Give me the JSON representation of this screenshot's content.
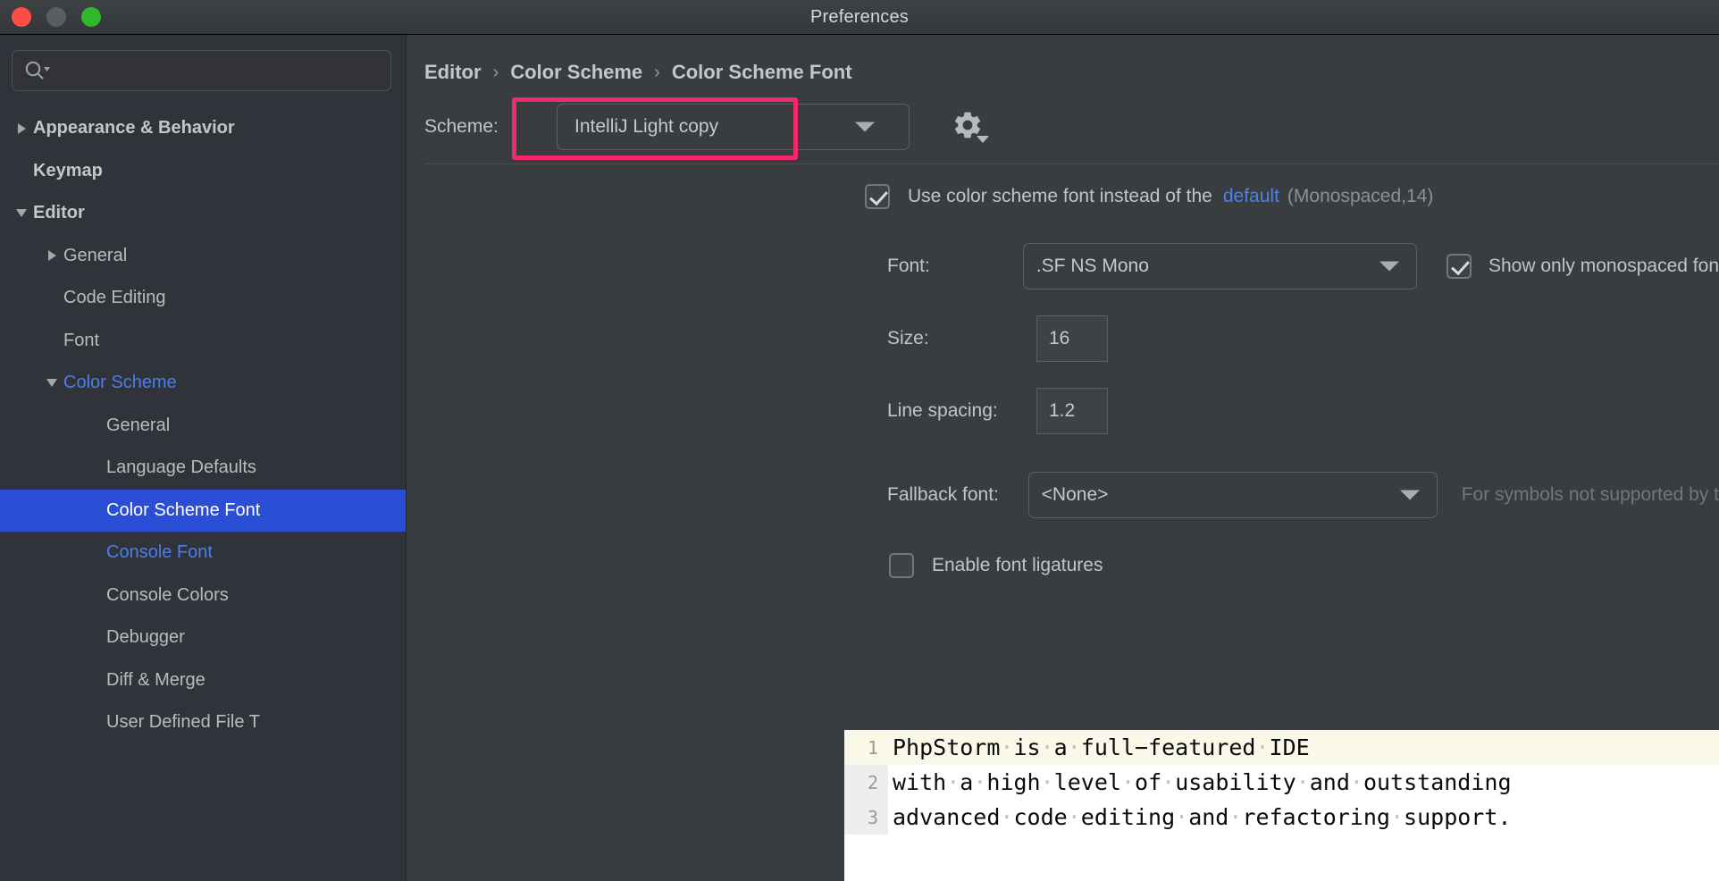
{
  "window": {
    "title": "Preferences",
    "traffic_lights": [
      "close-button",
      "minimize-button",
      "zoom-button"
    ]
  },
  "sidebar": {
    "search": {
      "value": "",
      "placeholder": "",
      "icon": "search-icon"
    },
    "items": [
      {
        "label": "Appearance & Behavior",
        "indent": 0,
        "arrow": "right",
        "style": "bold"
      },
      {
        "label": "Keymap",
        "indent": 0,
        "arrow": "none",
        "style": "bold"
      },
      {
        "label": "Editor",
        "indent": 0,
        "arrow": "down",
        "style": "bold"
      },
      {
        "label": "General",
        "indent": 1,
        "arrow": "right",
        "style": "normal"
      },
      {
        "label": "Code Editing",
        "indent": 1,
        "arrow": "none",
        "style": "normal"
      },
      {
        "label": "Font",
        "indent": 1,
        "arrow": "none",
        "style": "normal"
      },
      {
        "label": "Color Scheme",
        "indent": 1,
        "arrow": "down",
        "style": "modified"
      },
      {
        "label": "General",
        "indent": 2,
        "arrow": "none",
        "style": "normal"
      },
      {
        "label": "Language Defaults",
        "indent": 2,
        "arrow": "none",
        "style": "normal"
      },
      {
        "label": "Color Scheme Font",
        "indent": 2,
        "arrow": "none",
        "style": "selected"
      },
      {
        "label": "Console Font",
        "indent": 2,
        "arrow": "none",
        "style": "modified"
      },
      {
        "label": "Console Colors",
        "indent": 2,
        "arrow": "none",
        "style": "normal"
      },
      {
        "label": "Debugger",
        "indent": 2,
        "arrow": "none",
        "style": "normal"
      },
      {
        "label": "Diff & Merge",
        "indent": 2,
        "arrow": "none",
        "style": "normal"
      },
      {
        "label": "User Defined File T",
        "indent": 2,
        "arrow": "none",
        "style": "normal"
      }
    ]
  },
  "breadcrumb": {
    "items": [
      "Editor",
      "Color Scheme",
      "Color Scheme Font"
    ],
    "separator": "›"
  },
  "scheme": {
    "label": "Scheme:",
    "value": "IntelliJ Light copy",
    "dropdown_icon": "chevron-down-icon",
    "gear_icon": "gear-icon",
    "highlight_color": "#f5286b"
  },
  "settings": {
    "use_scheme_font": {
      "checked": true,
      "label": "Use color scheme font instead of the",
      "link": "default",
      "suffix": "(Monospaced,14)",
      "link_color": "#4a81ea"
    },
    "font": {
      "label": "Font:",
      "value": ".SF NS Mono"
    },
    "show_only_monospaced": {
      "checked": true,
      "label": "Show only monospaced fon"
    },
    "size": {
      "label": "Size:",
      "value": "16"
    },
    "line_spacing": {
      "label": "Line spacing:",
      "value": "1.2"
    },
    "fallback_font": {
      "label": "Fallback font:",
      "value": "<None>",
      "hint": "For symbols not supported by t"
    },
    "ligatures": {
      "checked": false,
      "label": "Enable font ligatures"
    }
  },
  "preview": {
    "caret_line": 1,
    "lines": [
      {
        "number": "1",
        "words": [
          "PhpStorm",
          "is",
          "a",
          "full−featured",
          "IDE"
        ]
      },
      {
        "number": "2",
        "words": [
          "with",
          "a",
          "high",
          "level",
          "of",
          "usability",
          "and",
          "outstanding"
        ]
      },
      {
        "number": "3",
        "words": [
          "advanced",
          "code",
          "editing",
          "and",
          "refactoring",
          "support."
        ]
      }
    ],
    "whitespace_glyph": "·"
  }
}
